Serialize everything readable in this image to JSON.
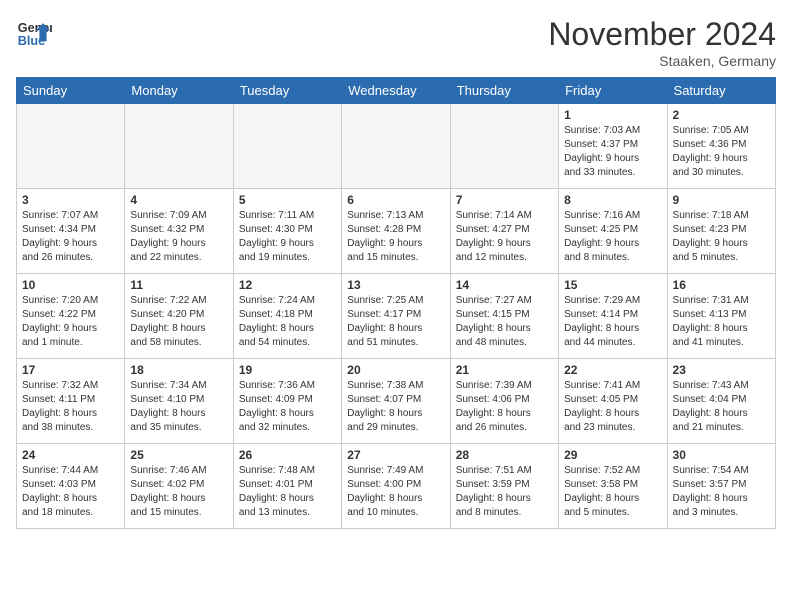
{
  "header": {
    "logo_line1": "General",
    "logo_line2": "Blue",
    "month": "November 2024",
    "location": "Staaken, Germany"
  },
  "days_of_week": [
    "Sunday",
    "Monday",
    "Tuesday",
    "Wednesday",
    "Thursday",
    "Friday",
    "Saturday"
  ],
  "weeks": [
    [
      {
        "num": "",
        "info": "",
        "empty": true
      },
      {
        "num": "",
        "info": "",
        "empty": true
      },
      {
        "num": "",
        "info": "",
        "empty": true
      },
      {
        "num": "",
        "info": "",
        "empty": true
      },
      {
        "num": "",
        "info": "",
        "empty": true
      },
      {
        "num": "1",
        "info": "Sunrise: 7:03 AM\nSunset: 4:37 PM\nDaylight: 9 hours\nand 33 minutes."
      },
      {
        "num": "2",
        "info": "Sunrise: 7:05 AM\nSunset: 4:36 PM\nDaylight: 9 hours\nand 30 minutes."
      }
    ],
    [
      {
        "num": "3",
        "info": "Sunrise: 7:07 AM\nSunset: 4:34 PM\nDaylight: 9 hours\nand 26 minutes."
      },
      {
        "num": "4",
        "info": "Sunrise: 7:09 AM\nSunset: 4:32 PM\nDaylight: 9 hours\nand 22 minutes."
      },
      {
        "num": "5",
        "info": "Sunrise: 7:11 AM\nSunset: 4:30 PM\nDaylight: 9 hours\nand 19 minutes."
      },
      {
        "num": "6",
        "info": "Sunrise: 7:13 AM\nSunset: 4:28 PM\nDaylight: 9 hours\nand 15 minutes."
      },
      {
        "num": "7",
        "info": "Sunrise: 7:14 AM\nSunset: 4:27 PM\nDaylight: 9 hours\nand 12 minutes."
      },
      {
        "num": "8",
        "info": "Sunrise: 7:16 AM\nSunset: 4:25 PM\nDaylight: 9 hours\nand 8 minutes."
      },
      {
        "num": "9",
        "info": "Sunrise: 7:18 AM\nSunset: 4:23 PM\nDaylight: 9 hours\nand 5 minutes."
      }
    ],
    [
      {
        "num": "10",
        "info": "Sunrise: 7:20 AM\nSunset: 4:22 PM\nDaylight: 9 hours\nand 1 minute."
      },
      {
        "num": "11",
        "info": "Sunrise: 7:22 AM\nSunset: 4:20 PM\nDaylight: 8 hours\nand 58 minutes."
      },
      {
        "num": "12",
        "info": "Sunrise: 7:24 AM\nSunset: 4:18 PM\nDaylight: 8 hours\nand 54 minutes."
      },
      {
        "num": "13",
        "info": "Sunrise: 7:25 AM\nSunset: 4:17 PM\nDaylight: 8 hours\nand 51 minutes."
      },
      {
        "num": "14",
        "info": "Sunrise: 7:27 AM\nSunset: 4:15 PM\nDaylight: 8 hours\nand 48 minutes."
      },
      {
        "num": "15",
        "info": "Sunrise: 7:29 AM\nSunset: 4:14 PM\nDaylight: 8 hours\nand 44 minutes."
      },
      {
        "num": "16",
        "info": "Sunrise: 7:31 AM\nSunset: 4:13 PM\nDaylight: 8 hours\nand 41 minutes."
      }
    ],
    [
      {
        "num": "17",
        "info": "Sunrise: 7:32 AM\nSunset: 4:11 PM\nDaylight: 8 hours\nand 38 minutes."
      },
      {
        "num": "18",
        "info": "Sunrise: 7:34 AM\nSunset: 4:10 PM\nDaylight: 8 hours\nand 35 minutes."
      },
      {
        "num": "19",
        "info": "Sunrise: 7:36 AM\nSunset: 4:09 PM\nDaylight: 8 hours\nand 32 minutes."
      },
      {
        "num": "20",
        "info": "Sunrise: 7:38 AM\nSunset: 4:07 PM\nDaylight: 8 hours\nand 29 minutes."
      },
      {
        "num": "21",
        "info": "Sunrise: 7:39 AM\nSunset: 4:06 PM\nDaylight: 8 hours\nand 26 minutes."
      },
      {
        "num": "22",
        "info": "Sunrise: 7:41 AM\nSunset: 4:05 PM\nDaylight: 8 hours\nand 23 minutes."
      },
      {
        "num": "23",
        "info": "Sunrise: 7:43 AM\nSunset: 4:04 PM\nDaylight: 8 hours\nand 21 minutes."
      }
    ],
    [
      {
        "num": "24",
        "info": "Sunrise: 7:44 AM\nSunset: 4:03 PM\nDaylight: 8 hours\nand 18 minutes."
      },
      {
        "num": "25",
        "info": "Sunrise: 7:46 AM\nSunset: 4:02 PM\nDaylight: 8 hours\nand 15 minutes."
      },
      {
        "num": "26",
        "info": "Sunrise: 7:48 AM\nSunset: 4:01 PM\nDaylight: 8 hours\nand 13 minutes."
      },
      {
        "num": "27",
        "info": "Sunrise: 7:49 AM\nSunset: 4:00 PM\nDaylight: 8 hours\nand 10 minutes."
      },
      {
        "num": "28",
        "info": "Sunrise: 7:51 AM\nSunset: 3:59 PM\nDaylight: 8 hours\nand 8 minutes."
      },
      {
        "num": "29",
        "info": "Sunrise: 7:52 AM\nSunset: 3:58 PM\nDaylight: 8 hours\nand 5 minutes."
      },
      {
        "num": "30",
        "info": "Sunrise: 7:54 AM\nSunset: 3:57 PM\nDaylight: 8 hours\nand 3 minutes."
      }
    ]
  ]
}
